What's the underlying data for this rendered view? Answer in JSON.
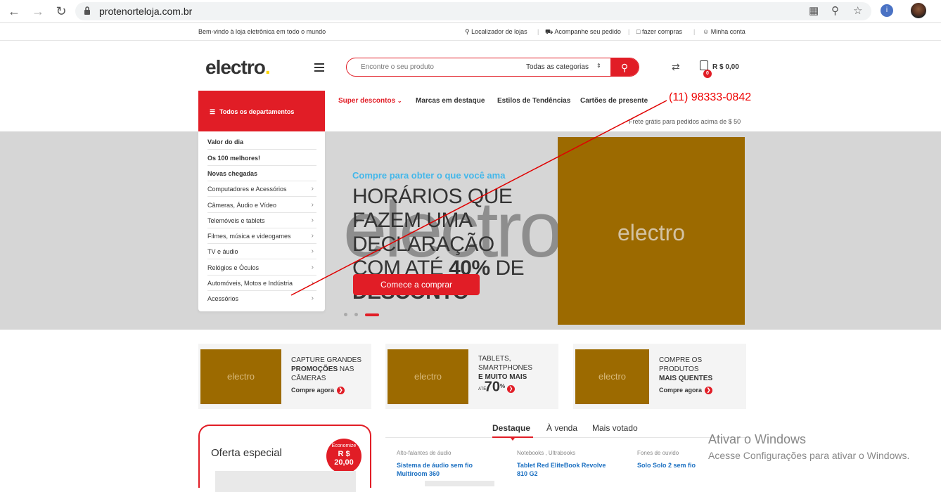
{
  "browser": {
    "url": "protenorteloja.com.br",
    "extension_label": "i"
  },
  "topbar": {
    "welcome": "Bem-vindo à loja eletrônica em todo o mundo",
    "links": [
      {
        "label": "Localizador de lojas",
        "icon": "map-pin-icon"
      },
      {
        "label": "Acompanhe seu pedido",
        "icon": "truck-icon"
      },
      {
        "label": "fazer compras",
        "icon": "shopping-bag-icon"
      },
      {
        "label": "Minha conta",
        "icon": "user-icon"
      }
    ]
  },
  "header": {
    "logo": "electro",
    "logo_dot": ".",
    "search_placeholder": "Encontre o seu produto",
    "search_category": "Todas as categorias",
    "cart_count": "0",
    "cart_total": "R $ 0,00"
  },
  "departments": {
    "title": "Todos os departamentos",
    "items": [
      {
        "label": "Valor do dia",
        "bold": true
      },
      {
        "label": "Os 100 melhores!",
        "bold": true
      },
      {
        "label": "Novas chegadas",
        "bold": true
      },
      {
        "label": "Computadores e Acessórios",
        "bold": false
      },
      {
        "label": "Câmeras, Áudio e Vídeo",
        "bold": false
      },
      {
        "label": "Telemóveis e tablets",
        "bold": false
      },
      {
        "label": "Filmes, música e videogames",
        "bold": false
      },
      {
        "label": "TV e áudio",
        "bold": false
      },
      {
        "label": "Relógios e Óculos",
        "bold": false
      },
      {
        "label": "Automóveis, Motos e Indústria",
        "bold": false
      },
      {
        "label": "Acessórios",
        "bold": false
      }
    ]
  },
  "mainnav": {
    "items": [
      "Super descontos",
      "Marcas em destaque",
      "Estilos de Tendências",
      "Cartões de presente"
    ],
    "free_shipping": "Frete grátis para pedidos acima de $ 50"
  },
  "annotation": {
    "phone": "(11) 98333-0842",
    "color": "#e00000"
  },
  "hero": {
    "subtitle": "Compre para obter o que você ama",
    "title_line1": "HORÁRIOS QUE",
    "title_line2": "FAZEM UMA",
    "title_line3": "DECLARAÇÃO",
    "title_line4_pre": "COM ATÉ ",
    "title_line4_bold": "40%",
    "title_line4_post": " DE",
    "title_line5": "DESCONTO",
    "watermark": "electro",
    "cta": "Comece a comprar",
    "image_label": "electro",
    "active_slide": 3,
    "slide_count": 3
  },
  "promos": [
    {
      "image_label": "electro",
      "line1": "CAPTURE GRANDES",
      "bold": "PROMOÇÕES",
      "line2": " NAS",
      "line3": "CÂMERAS",
      "link": "Compre agora"
    },
    {
      "image_label": "electro",
      "line1": "TABLETS,",
      "line2": "SMARTPHONES",
      "bold": "E MUITO MAIS",
      "upto": "ATÉ",
      "percent": "70",
      "percent_sign": "%"
    },
    {
      "image_label": "electro",
      "line1": "COMPRE OS",
      "line2": "PRODUTOS",
      "bold": "MAIS QUENTES",
      "link": "Compre agora"
    }
  ],
  "offer": {
    "title": "Oferta especial",
    "badge_save": "Economize",
    "badge_amount_1": "R $",
    "badge_amount_2": "20,00"
  },
  "tabs": {
    "items": [
      "Destaque",
      "À venda",
      "Mais votado"
    ],
    "active": 0
  },
  "products": [
    {
      "category": "Alto-falantes de áudio",
      "name_1": "Sistema de áudio sem fio",
      "name_2": "Multiroom 360"
    },
    {
      "category": "Notebooks , Ultrabooks",
      "name_1": "Tablet Red EliteBook Revolve",
      "name_2": "810 G2"
    },
    {
      "category": "Fones de ouvido",
      "name_1": "Solo Solo 2 sem fio",
      "name_2": ""
    }
  ],
  "windows_watermark": {
    "title": "Ativar o Windows",
    "subtitle": "Acesse Configurações para ativar o Windows."
  },
  "colors": {
    "accent": "#e11d26",
    "hero_bg": "#d6d6d6",
    "placeholder": "#9c6a00",
    "link_blue": "#1a6fc1"
  }
}
